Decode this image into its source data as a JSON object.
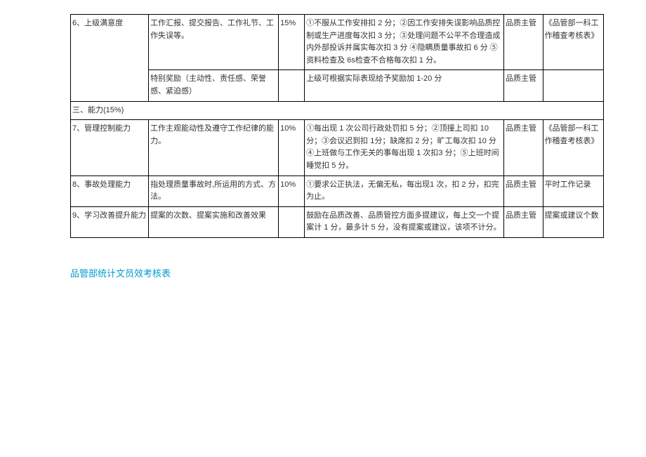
{
  "table": {
    "row6": {
      "label": "6、上级满意度",
      "desc": "工作汇报、提交报告、工作礼节、工作失误等。",
      "weight": "15%",
      "criteria": "①不服从工作安排扣 2 分；②因工作安排失误影响品质控制或生产进度每次扣 3 分；③处理问题不公平不合理造成内外部投诉并属实每次扣 3 分 ④隐瞒质量事故扣 6 分 ⑤资料检查及 6s检查不合格每次扣 1 分。",
      "person": "品质主管",
      "source": "《品管部一科工作稽查考核表》"
    },
    "row_bonus": {
      "desc": "特别奖励（主动性、责任感、荣誉感、紧迫感）",
      "criteria": "上级可根据实际表现给予奖励加 1-20 分",
      "person": "品质主管"
    },
    "section3": {
      "title": "三、能力(15%)"
    },
    "row7": {
      "label": "7、管理控制能力",
      "desc": "工作主观能动性及遵守工作纪律的能力。",
      "weight": "10%",
      "criteria": "①每出现 1 次公司行政处罚扣 5 分；②顶撞上司扣 10 分；③会议迟到扣 1分；缺席扣 2 分；旷工每次扣 10 分④上班做与工作无关的事每出现 1 次扣3 分；⑤上班时间睡觉扣 5 分。",
      "person": "品质主管",
      "source": "《品管部一科工作稽查考核表》"
    },
    "row8": {
      "label": "8、事故处理能力",
      "desc": "指处理质量事故时,所运用的方式、方法。",
      "weight": "10%",
      "criteria": "①要求公正执法，无偏无私，每出现1 次，扣 2 分，扣完为止。",
      "person": "品质主管",
      "source": "平时工作记录"
    },
    "row9": {
      "label": "9、学习改善提升能力",
      "desc": "提案的次数、提案实施和改善效果",
      "weight": "",
      "criteria": "鼓励在品质改善、品质管控方面多提建议，每上交一个提案计 1 分，最多计 5 分，没有提案或建议，该项不计分。",
      "person": "品质主管",
      "source": "提案或建议个数"
    }
  },
  "footer": {
    "link_text": "品管部统计文员效考核表"
  }
}
